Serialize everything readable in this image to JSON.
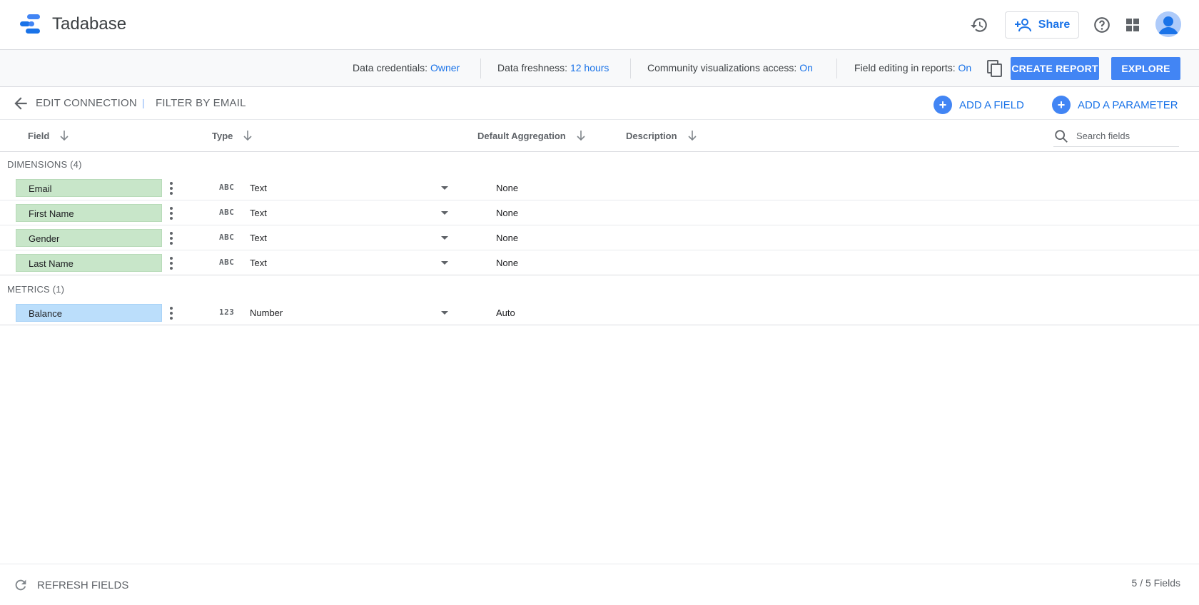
{
  "header": {
    "app_title": "Tadabase",
    "share_label": "Share",
    "icons": [
      "history-icon",
      "share-person-icon",
      "help-icon",
      "apps-grid-icon",
      "account-avatar-icon"
    ]
  },
  "subbar": {
    "credentials_label": "Data credentials:",
    "credentials_value": "Owner",
    "freshness_label": "Data freshness:",
    "freshness_value": "12 hours",
    "community_label": "Community visualizations access:",
    "community_value": "On",
    "field_editing_label": "Field editing in reports:",
    "field_editing_value": "On",
    "create_report_label": "CREATE REPORT",
    "explore_label": "EXPLORE"
  },
  "crumbs": {
    "edit_connection": "EDIT CONNECTION",
    "separator": "|",
    "source_name": "FILTER BY EMAIL",
    "add_field": "ADD A FIELD",
    "add_parameter": "ADD A PARAMETER"
  },
  "columns": {
    "field": "Field",
    "type": "Type",
    "default_aggregation": "Default Aggregation",
    "description": "Description",
    "search_placeholder": "Search fields"
  },
  "dimensions": {
    "label": "DIMENSIONS (4)",
    "rows": [
      {
        "name": "Email",
        "type_icon": "ABC",
        "type": "Text",
        "aggregation": "None"
      },
      {
        "name": "First Name",
        "type_icon": "ABC",
        "type": "Text",
        "aggregation": "None"
      },
      {
        "name": "Gender",
        "type_icon": "ABC",
        "type": "Text",
        "aggregation": "None"
      },
      {
        "name": "Last Name",
        "type_icon": "ABC",
        "type": "Text",
        "aggregation": "None"
      }
    ]
  },
  "metrics": {
    "label": "METRICS (1)",
    "rows": [
      {
        "name": "Balance",
        "type_icon": "123",
        "type": "Number",
        "aggregation": "Auto"
      }
    ]
  },
  "footer": {
    "refresh_label": "REFRESH FIELDS",
    "field_count": "5 / 5 Fields"
  },
  "colors": {
    "accent": "#1a73e8",
    "primary_button": "#4285f4",
    "dimension_chip": "#c8e6c9",
    "metric_chip": "#bbdefb"
  }
}
